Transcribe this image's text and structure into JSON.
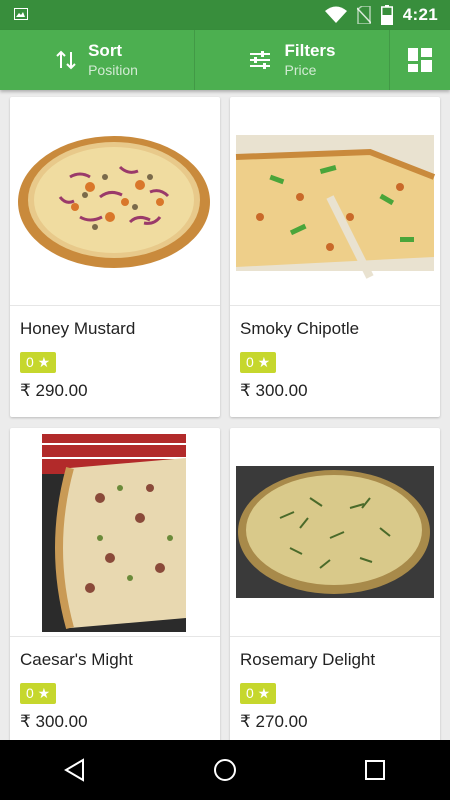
{
  "status_bar": {
    "time": "4:21",
    "icons": [
      "image-icon",
      "wifi-icon",
      "no-sim-icon",
      "battery-icon"
    ]
  },
  "toolbar": {
    "sort": {
      "title": "Sort",
      "subtitle": "Position",
      "icon": "sort-arrows-icon"
    },
    "filters": {
      "title": "Filters",
      "subtitle": "Price",
      "icon": "sliders-icon"
    },
    "grid_toggle_icon": "grid-view-icon"
  },
  "products": [
    {
      "name": "Honey Mustard",
      "rating": "0 ★",
      "price": "₹ 290.00"
    },
    {
      "name": "Smoky Chipotle",
      "rating": "0 ★",
      "price": "₹ 300.00"
    },
    {
      "name": "Caesar's Might",
      "rating": "0 ★",
      "price": "₹ 300.00"
    },
    {
      "name": "Rosemary Delight",
      "rating": "0 ★",
      "price": "₹ 270.00"
    }
  ],
  "colors": {
    "status_bar": "#388e3c",
    "toolbar": "#4caf50",
    "rating_badge": "#c6d72d",
    "background": "#ececec"
  },
  "nav_bar": {
    "icons": [
      "back-icon",
      "home-icon",
      "recents-icon"
    ]
  }
}
